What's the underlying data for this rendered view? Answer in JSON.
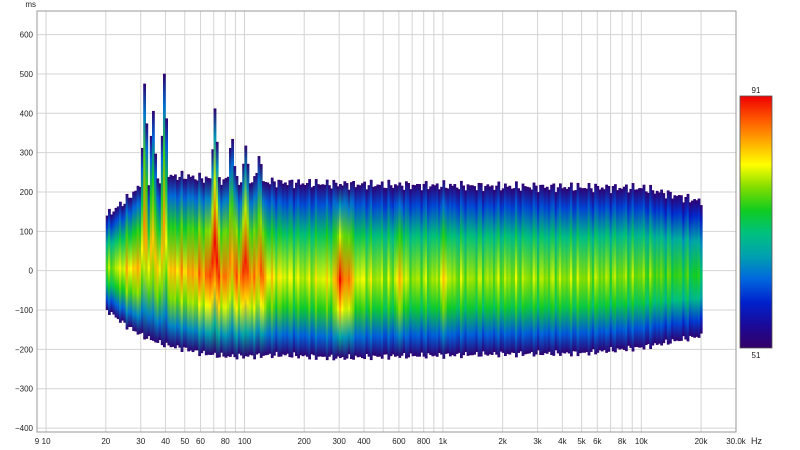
{
  "chart_data": {
    "type": "heatmap",
    "title": "",
    "y_unit_label": "ms",
    "x_unit_label": "Hz",
    "x_scale": "log",
    "x_range_hz": [
      9,
      30000
    ],
    "y_range_ms": [
      -410,
      660
    ],
    "x_ticks": [
      {
        "value": 9,
        "label": "9"
      },
      {
        "value": 10,
        "label": "10"
      },
      {
        "value": 20,
        "label": "20"
      },
      {
        "value": 30,
        "label": "30"
      },
      {
        "value": 40,
        "label": "40"
      },
      {
        "value": 50,
        "label": "50"
      },
      {
        "value": 60,
        "label": "60"
      },
      {
        "value": 80,
        "label": "80"
      },
      {
        "value": 100,
        "label": "100"
      },
      {
        "value": 200,
        "label": "200"
      },
      {
        "value": 300,
        "label": "300"
      },
      {
        "value": 400,
        "label": "400"
      },
      {
        "value": 600,
        "label": "600"
      },
      {
        "value": 800,
        "label": "800"
      },
      {
        "value": 1000,
        "label": "1k"
      },
      {
        "value": 2000,
        "label": "2k"
      },
      {
        "value": 3000,
        "label": "3k"
      },
      {
        "value": 4000,
        "label": "4k"
      },
      {
        "value": 5000,
        "label": "5k"
      },
      {
        "value": 6000,
        "label": "6k"
      },
      {
        "value": 8000,
        "label": "8k"
      },
      {
        "value": 10000,
        "label": "10k"
      },
      {
        "value": 20000,
        "label": "20k"
      },
      {
        "value": 30000,
        "label": "30.0k"
      }
    ],
    "x_minor_gridlines_hz": [
      70,
      90,
      500,
      700,
      900,
      7000,
      9000
    ],
    "y_ticks": [
      {
        "value": 600,
        "label": "600"
      },
      {
        "value": 500,
        "label": "500"
      },
      {
        "value": 400,
        "label": "400"
      },
      {
        "value": 300,
        "label": "300"
      },
      {
        "value": 200,
        "label": "200"
      },
      {
        "value": 100,
        "label": "100"
      },
      {
        "value": 0,
        "label": "0"
      },
      {
        "value": -100,
        "label": "−100"
      },
      {
        "value": -200,
        "label": "−200"
      },
      {
        "value": -300,
        "label": "−300"
      },
      {
        "value": -400,
        "label": "−400"
      }
    ],
    "grid": true,
    "colorbar": {
      "max_label": "91",
      "min_label": "51",
      "max": 91,
      "min": 51,
      "placement": "right",
      "colors": [
        "#330066",
        "#1a0a99",
        "#0022cc",
        "#0066dd",
        "#00a0b0",
        "#00c080",
        "#10cc20",
        "#80dd00",
        "#ffff00",
        "#ffaa00",
        "#ff5500",
        "#ee0000"
      ]
    },
    "data_extent": {
      "x_hz": [
        20,
        20000
      ]
    },
    "envelope": {
      "x_hz": [
        20,
        25,
        30,
        35,
        40,
        50,
        60,
        70,
        80,
        100,
        130,
        160,
        200,
        300,
        500,
        1000,
        2000,
        5000,
        10000,
        20000
      ],
      "top_ms": [
        140,
        180,
        220,
        230,
        240,
        240,
        235,
        232,
        230,
        228,
        226,
        224,
        222,
        220,
        218,
        216,
        214,
        212,
        210,
        175
      ],
      "bottom_ms": [
        -100,
        -140,
        -165,
        -180,
        -190,
        -200,
        -210,
        -215,
        -218,
        -218,
        -215,
        -215,
        -218,
        -222,
        -218,
        -215,
        -212,
        -210,
        -195,
        -165
      ],
      "peak_level_db": [
        78,
        84,
        86,
        85,
        85,
        86,
        88,
        91,
        88,
        89,
        84,
        82,
        81,
        84,
        80,
        80,
        80,
        80,
        79,
        75
      ]
    },
    "early_ridges": [
      {
        "hz": 31,
        "top_ms": 500
      },
      {
        "hz": 34,
        "top_ms": 430
      },
      {
        "hz": 39,
        "top_ms": 525
      },
      {
        "hz": 70,
        "top_ms": 420
      },
      {
        "hz": 85,
        "top_ms": 360
      },
      {
        "hz": 100,
        "top_ms": 320
      },
      {
        "hz": 117,
        "top_ms": 300
      }
    ],
    "hotspots": [
      {
        "hz": 70,
        "ms": 10,
        "level_db": 91
      },
      {
        "hz": 100,
        "ms": 15,
        "level_db": 90
      },
      {
        "hz": 120,
        "ms": 10,
        "level_db": 88
      },
      {
        "hz": 300,
        "ms": 5,
        "level_db": 91
      },
      {
        "hz": 330,
        "ms": 5,
        "level_db": 87
      },
      {
        "hz": 600,
        "ms": 5,
        "level_db": 84
      },
      {
        "hz": 1000,
        "ms": 5,
        "level_db": 83
      }
    ]
  }
}
